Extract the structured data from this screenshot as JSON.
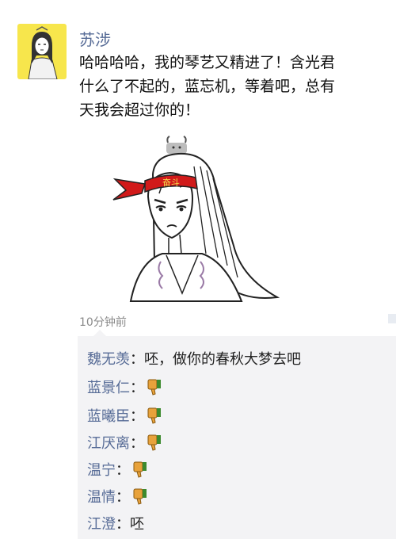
{
  "post": {
    "username": "苏涉",
    "text_lines": [
      "哈哈哈哈，我的琴艺又精进了！含光君",
      "什么了不起的，蓝忘机，等着吧，总有",
      "天我会超过你的！"
    ],
    "headband_text": "奋斗",
    "timestamp": "10分钟前"
  },
  "comments": [
    {
      "author": "魏无羡",
      "sep": "：",
      "text": "呸，做你的春秋大梦去吧",
      "icon": "thumbs-down-icon"
    },
    {
      "author": "蓝景仁",
      "sep": "：",
      "text": "",
      "icon": "thumbs-down-icon"
    },
    {
      "author": "蓝曦臣",
      "sep": "：",
      "text": "",
      "icon": "thumbs-down-icon"
    },
    {
      "author": "江厌离",
      "sep": "：",
      "text": "",
      "icon": "thumbs-down-icon"
    },
    {
      "author": "温宁",
      "sep": "：",
      "text": "",
      "icon": "thumbs-down-icon"
    },
    {
      "author": "温情",
      "sep": "：",
      "text": "",
      "icon": "thumbs-down-icon"
    },
    {
      "author": "江澄",
      "sep": "：",
      "text": "呸",
      "icon": ""
    }
  ],
  "colors": {
    "author": "#566b96",
    "comment_bg": "#f3f3f5",
    "avatar_bg": "#f7e64c",
    "headband": "#d11a1a",
    "thumb": "#e8a23b"
  }
}
